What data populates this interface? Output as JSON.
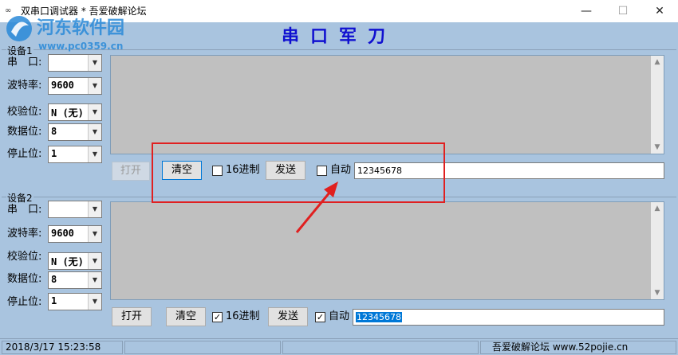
{
  "window": {
    "title": "双串口调试器  * 吾爱破解论坛",
    "app_icon": "∞",
    "min_glyph": "—",
    "max_glyph": "☐",
    "close_glyph": "✕"
  },
  "watermark": {
    "line1": "河东软件园",
    "line2": "www.pc0359.cn"
  },
  "banner": {
    "title": "串口军刀"
  },
  "labels": {
    "port": "串　口:",
    "baud": "波特率:",
    "parity": "校验位:",
    "databits": "数据位:",
    "stopbits": "停止位:"
  },
  "device1": {
    "group_label": "设备1",
    "port_value": "",
    "baud_value": "9600",
    "parity_value": "N (无)",
    "databits_value": "8",
    "stopbits_value": "1",
    "open_label": "打开",
    "open_enabled": false,
    "clear_label": "清空",
    "hex_label": "16进制",
    "hex_checked": false,
    "send_label": "发送",
    "auto_label": "自动",
    "auto_checked": false,
    "send_text": "12345678"
  },
  "device2": {
    "group_label": "设备2",
    "port_value": "",
    "baud_value": "9600",
    "parity_value": "N (无)",
    "databits_value": "8",
    "stopbits_value": "1",
    "open_label": "打开",
    "open_enabled": true,
    "clear_label": "清空",
    "hex_label": "16进制",
    "hex_checked": true,
    "send_label": "发送",
    "auto_label": "自动",
    "auto_checked": true,
    "send_text": "12345678"
  },
  "status": {
    "datetime": "2018/3/17 15:23:58",
    "credit": "吾爱破解论坛 www.52pojie.cn"
  },
  "colors": {
    "window_bg": "#a9c4df",
    "banner": "#1010d0",
    "highlight": "#e02020",
    "selection": "#0078d7"
  }
}
